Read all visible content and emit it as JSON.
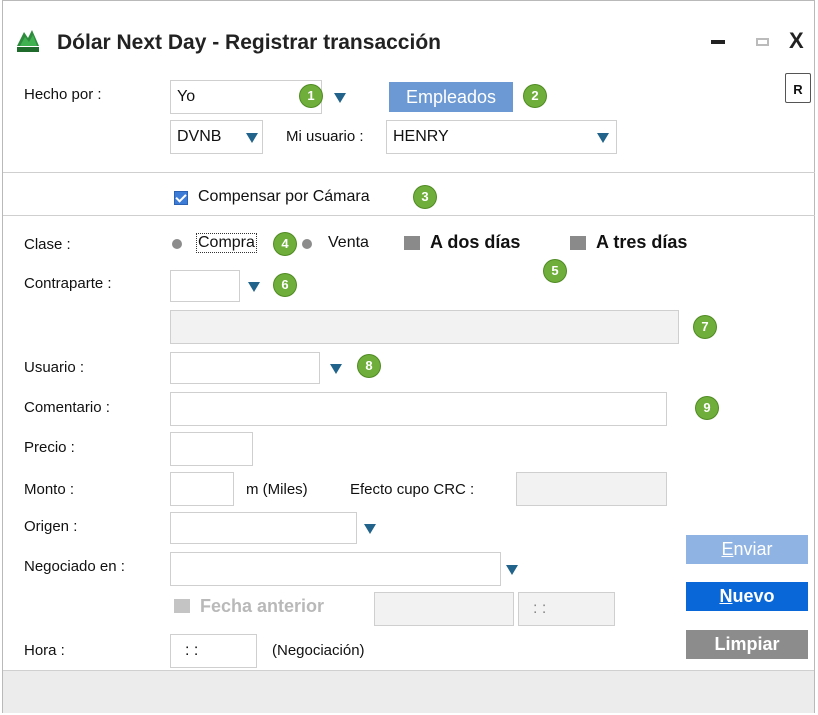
{
  "window": {
    "title": "Dólar Next Day - Registrar transacción",
    "controls": {
      "minimize": "minimize",
      "maximize": "maximize",
      "close": "X"
    }
  },
  "doc_icon_label": "R",
  "hecho_por": {
    "label": "Hecho por :",
    "value": "Yo",
    "employees_button": "Empleados",
    "desk_value": "DVNB",
    "mi_usuario_label": "Mi usuario :",
    "mi_usuario_value": "HENRY"
  },
  "compensar": {
    "label": "Compensar por Cámara",
    "checked": true
  },
  "clase": {
    "label": "Clase :",
    "options": [
      "Compra",
      "Venta"
    ],
    "a_dos_dias": "A dos días",
    "a_tres_dias": "A tres días"
  },
  "contraparte": {
    "label": "Contraparte :",
    "value": "",
    "name_value": ""
  },
  "usuario": {
    "label": "Usuario :",
    "value": ""
  },
  "comentario": {
    "label": "Comentario :",
    "value": ""
  },
  "precio": {
    "label": "Precio :",
    "value": ""
  },
  "monto": {
    "label": "Monto :",
    "value": "",
    "unit": "m (Miles)",
    "efecto_label": "Efecto cupo CRC :",
    "efecto_value": ""
  },
  "origen": {
    "label": "Origen :",
    "value": ""
  },
  "negociado": {
    "label": "Negociado en :",
    "value": ""
  },
  "fecha_anterior": {
    "label": "Fecha anterior",
    "date": "",
    "time": ": :"
  },
  "hora": {
    "label": "Hora :",
    "value": ": :",
    "suffix": "(Negociación)"
  },
  "buttons": {
    "enviar": "Enviar",
    "nuevo": "Nuevo",
    "limpiar": "Limpiar"
  },
  "badges": [
    "1",
    "2",
    "3",
    "4",
    "5",
    "6",
    "7",
    "8",
    "9"
  ],
  "colors": {
    "badge": "#6fae3a",
    "empleados": "#6c99d3",
    "enviar_disabled": "#8fb3e3",
    "nuevo": "#0a67d8",
    "limpiar": "#8c8c8c",
    "dropdown_arrow": "#21638a"
  }
}
